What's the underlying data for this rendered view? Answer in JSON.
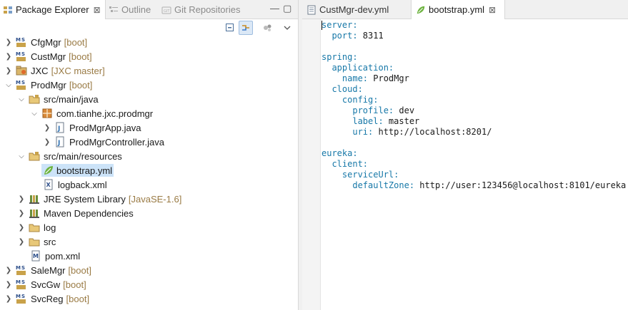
{
  "explorer": {
    "tabs": [
      {
        "label": "Package Explorer",
        "close": "⊠"
      },
      {
        "label": "Outline"
      },
      {
        "label": "Git Repositories"
      }
    ],
    "window_controls": {
      "minimize": "—",
      "maximize": "▢"
    },
    "tree": [
      {
        "label": "CfgMgr",
        "deco": "[boot]"
      },
      {
        "label": "CustMgr",
        "deco": "[boot]"
      },
      {
        "label": "JXC",
        "deco": "[JXC master]"
      },
      {
        "label": "ProdMgr",
        "deco": "[boot]"
      },
      {
        "label": "src/main/java",
        "deco": ""
      },
      {
        "label": "com.tianhe.jxc.prodmgr",
        "deco": ""
      },
      {
        "label": "ProdMgrApp.java",
        "deco": ""
      },
      {
        "label": "ProdMgrController.java",
        "deco": ""
      },
      {
        "label": "src/main/resources",
        "deco": ""
      },
      {
        "label": "bootstrap.yml",
        "deco": ""
      },
      {
        "label": "logback.xml",
        "deco": ""
      },
      {
        "label": "JRE System Library",
        "deco": "[JavaSE-1.6]"
      },
      {
        "label": "Maven Dependencies",
        "deco": ""
      },
      {
        "label": "log",
        "deco": ""
      },
      {
        "label": "src",
        "deco": ""
      },
      {
        "label": "pom.xml",
        "deco": ""
      },
      {
        "label": "SaleMgr",
        "deco": "[boot]"
      },
      {
        "label": "SvcGw",
        "deco": "[boot]"
      },
      {
        "label": "SvcReg",
        "deco": "[boot]"
      }
    ]
  },
  "editor": {
    "tabs": [
      {
        "label": "CustMgr-dev.yml"
      },
      {
        "label": "bootstrap.yml",
        "close": "⊠"
      }
    ],
    "lines": [
      {
        "k": "server:",
        "v": ""
      },
      {
        "k": "  port:",
        "v": " 8311"
      },
      {
        "k": "",
        "v": ""
      },
      {
        "k": "spring:",
        "v": ""
      },
      {
        "k": "  application:",
        "v": ""
      },
      {
        "k": "    name:",
        "v": " ProdMgr"
      },
      {
        "k": "  cloud:",
        "v": ""
      },
      {
        "k": "    config:",
        "v": ""
      },
      {
        "k": "      profile:",
        "v": " dev"
      },
      {
        "k": "      label:",
        "v": " master"
      },
      {
        "k": "      uri:",
        "v": " http://localhost:8201/"
      },
      {
        "k": "",
        "v": ""
      },
      {
        "k": "eureka:",
        "v": ""
      },
      {
        "k": "  client:",
        "v": ""
      },
      {
        "k": "    serviceUrl:",
        "v": ""
      },
      {
        "k": "      defaultZone:",
        "v": " http://user:123456@localhost:8101/eureka"
      }
    ]
  },
  "colors": {
    "yaml_key": "#1778a8",
    "decoration": "#9a7b45",
    "selection": "#cce3f8"
  }
}
